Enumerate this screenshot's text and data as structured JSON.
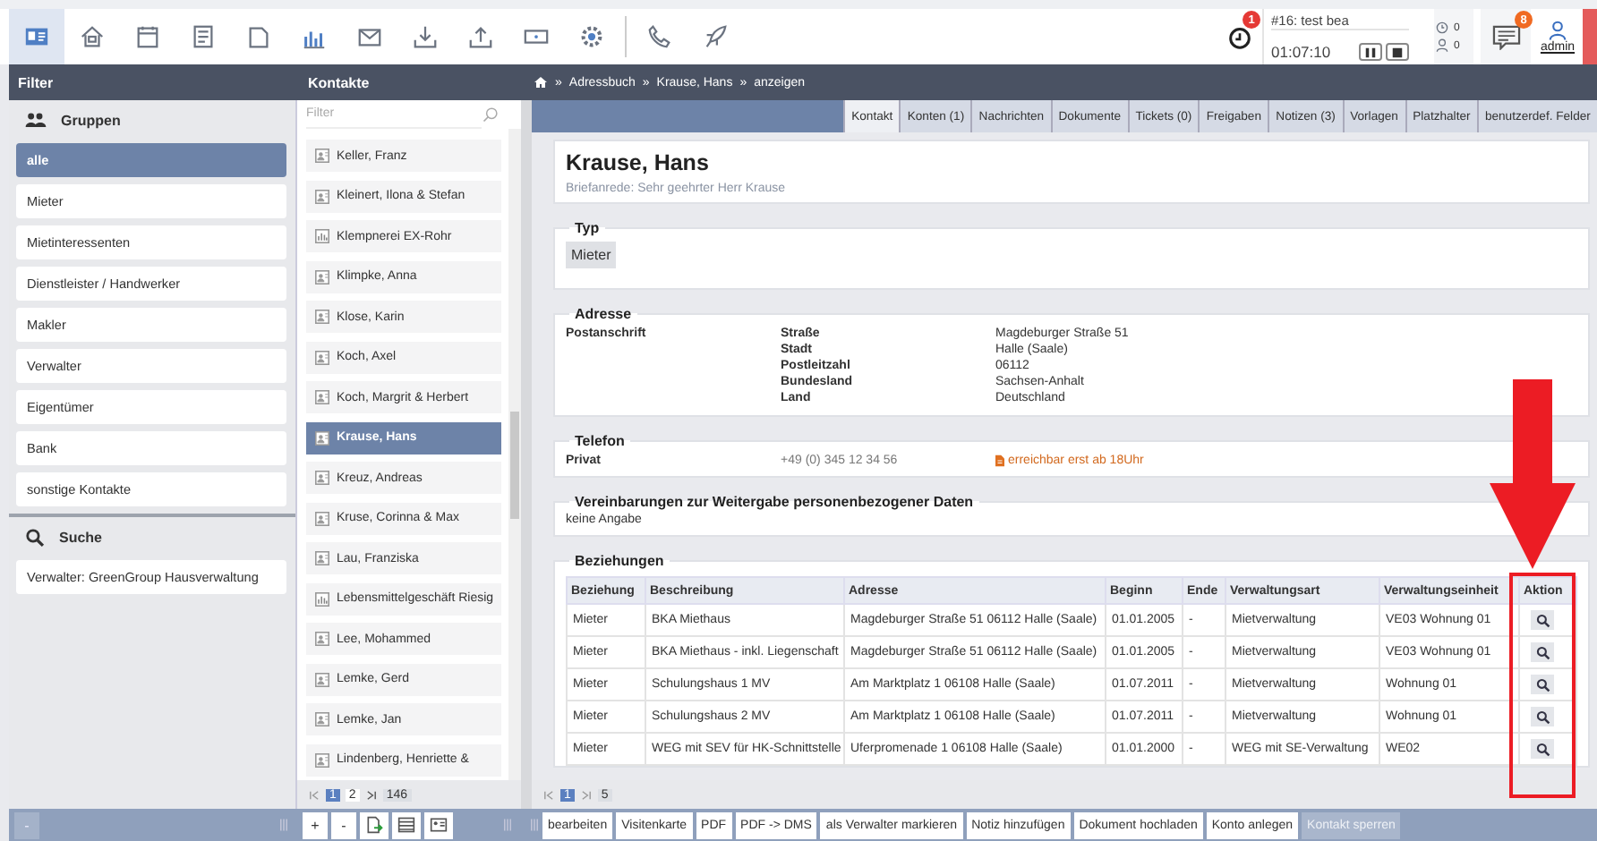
{
  "toolbar": {
    "buttons": [
      {
        "kind": "contacts",
        "selected": true
      },
      {
        "kind": "house",
        "selected": false
      },
      {
        "kind": "calendar",
        "selected": false
      },
      {
        "kind": "form",
        "selected": false
      },
      {
        "kind": "pages",
        "selected": false
      },
      {
        "kind": "chart",
        "selected": false
      },
      {
        "kind": "mail",
        "selected": false
      },
      {
        "kind": "download",
        "selected": false
      },
      {
        "kind": "upload",
        "selected": false
      },
      {
        "kind": "ticket",
        "selected": false
      },
      {
        "kind": "gear",
        "selected": false
      }
    ],
    "tools": [
      {
        "kind": "phone"
      },
      {
        "kind": "rocket"
      }
    ]
  },
  "status": {
    "alarm_badge": "1",
    "task": "#16: test bea",
    "timer": "01:07:10",
    "counters": [
      {
        "kind": "clock",
        "count": "0"
      },
      {
        "kind": "person",
        "count": "0"
      }
    ],
    "messages_badge": "8",
    "user": "admin"
  },
  "filter_panel": {
    "title": "Filter",
    "groups_heading": "Gruppen",
    "groups": [
      {
        "label": "alle",
        "selected": true
      },
      {
        "label": "Mieter",
        "selected": false
      },
      {
        "label": "Mietinteressenten",
        "selected": false
      },
      {
        "label": "Dienstleister / Handwerker",
        "selected": false
      },
      {
        "label": "Makler",
        "selected": false
      },
      {
        "label": "Verwalter",
        "selected": false
      },
      {
        "label": "Eigentümer",
        "selected": false
      },
      {
        "label": "Bank",
        "selected": false
      },
      {
        "label": "sonstige Kontakte",
        "selected": false
      }
    ],
    "search_heading": "Suche",
    "searches": [
      "Verwalter: GreenGroup Hausverwaltung"
    ],
    "collapse": "-"
  },
  "contacts_panel": {
    "title": "Kontakte",
    "filter_placeholder": "Filter",
    "contacts": [
      {
        "name": "Keller, Franz",
        "kind": "person",
        "selected": false
      },
      {
        "name": "Kleinert, Ilona & Stefan",
        "kind": "person",
        "selected": false
      },
      {
        "name": "Klempnerei EX-Rohr",
        "kind": "company",
        "selected": false
      },
      {
        "name": "Klimpke, Anna",
        "kind": "person",
        "selected": false
      },
      {
        "name": "Klose, Karin",
        "kind": "person",
        "selected": false
      },
      {
        "name": "Koch, Axel",
        "kind": "person",
        "selected": false
      },
      {
        "name": "Koch, Margrit & Herbert",
        "kind": "person",
        "selected": false
      },
      {
        "name": "Krause, Hans",
        "kind": "person",
        "selected": true
      },
      {
        "name": "Kreuz, Andreas",
        "kind": "person",
        "selected": false
      },
      {
        "name": "Kruse, Corinna & Max",
        "kind": "person",
        "selected": false
      },
      {
        "name": "Lau, Franziska",
        "kind": "person",
        "selected": false
      },
      {
        "name": "Lebensmittelgeschäft Riesig",
        "kind": "company",
        "selected": false
      },
      {
        "name": "Lee, Mohammed",
        "kind": "person",
        "selected": false
      },
      {
        "name": "Lemke, Gerd",
        "kind": "person",
        "selected": false
      },
      {
        "name": "Lemke, Jan",
        "kind": "person",
        "selected": false
      },
      {
        "name": "Lindenberg, Henriette &",
        "kind": "person",
        "selected": false
      }
    ],
    "pager": {
      "pages": [
        {
          "label": "1",
          "selected": true
        },
        {
          "label": "2",
          "selected": false
        }
      ],
      "total": "146"
    },
    "tools": [
      "+",
      "-"
    ]
  },
  "breadcrumb": {
    "separator": "»",
    "items": [
      "Adressbuch",
      "Krause, Hans",
      "anzeigen"
    ]
  },
  "tabs": [
    {
      "label": "Kontakt",
      "selected": true
    },
    {
      "label": "Konten (1)",
      "selected": false
    },
    {
      "label": "Nachrichten",
      "selected": false
    },
    {
      "label": "Dokumente",
      "selected": false
    },
    {
      "label": "Tickets (0)",
      "selected": false
    },
    {
      "label": "Freigaben",
      "selected": false
    },
    {
      "label": "Notizen (3)",
      "selected": false
    },
    {
      "label": "Vorlagen",
      "selected": false
    },
    {
      "label": "Platzhalter",
      "selected": false
    },
    {
      "label": "benutzerdef. Felder",
      "selected": false
    }
  ],
  "contact": {
    "name": "Krause, Hans",
    "salutation": "Briefanrede: Sehr geehrter Herr Krause",
    "type_legend": "Typ",
    "types": [
      "Mieter"
    ],
    "address_legend": "Adresse",
    "address_label": "Postanschrift",
    "address_fields": [
      {
        "label": "Straße",
        "value": "Magdeburger Straße 51"
      },
      {
        "label": "Stadt",
        "value": "Halle (Saale)"
      },
      {
        "label": "Postleitzahl",
        "value": "06112"
      },
      {
        "label": "Bundesland",
        "value": "Sachsen-Anhalt"
      },
      {
        "label": "Land",
        "value": "Deutschland"
      }
    ],
    "phone_legend": "Telefon",
    "phones": [
      {
        "label": "Privat",
        "number": "+49 (0) 345 12 34 56",
        "note": "erreichbar erst ab 18Uhr"
      }
    ],
    "consent_legend": "Vereinbarungen zur Weitergabe personenbezogener Daten",
    "consent": "keine Angabe",
    "relations_legend": "Beziehungen",
    "relations": {
      "columns": [
        "Beziehung",
        "Beschreibung",
        "Adresse",
        "Beginn",
        "Ende",
        "Verwaltungsart",
        "Verwaltungseinheit",
        "Aktion"
      ],
      "rows": [
        [
          "Mieter",
          "BKA Miethaus",
          "Magdeburger Straße 51 06112 Halle (Saale)",
          "01.01.2005",
          "-",
          "Mietverwaltung",
          "VE03 Wohnung 01"
        ],
        [
          "Mieter",
          "BKA Miethaus - inkl. Liegenschaft",
          "Magdeburger Straße 51 06112 Halle (Saale)",
          "01.01.2005",
          "-",
          "Mietverwaltung",
          "VE03 Wohnung 01"
        ],
        [
          "Mieter",
          "Schulungshaus 1 MV",
          "Am Marktplatz 1 06108 Halle (Saale)",
          "01.07.2011",
          "-",
          "Mietverwaltung",
          "Wohnung 01"
        ],
        [
          "Mieter",
          "Schulungshaus 2 MV",
          "Am Marktplatz 1 06108 Halle (Saale)",
          "01.07.2011",
          "-",
          "Mietverwaltung",
          "Wohnung 01"
        ],
        [
          "Mieter",
          "WEG mit SEV für HK-Schnittstelle",
          "Uferpromenade 1 06108 Halle (Saale)",
          "01.01.2000",
          "-",
          "WEG mit SE-Verwaltung",
          "WE02"
        ]
      ]
    },
    "pager": {
      "pages": [
        {
          "label": "1",
          "selected": true
        }
      ],
      "total": "5"
    }
  },
  "actions": [
    {
      "label": "bearbeiten",
      "disabled": false
    },
    {
      "label": "Visitenkarte",
      "disabled": false
    },
    {
      "label": "PDF",
      "disabled": false
    },
    {
      "label": "PDF -> DMS",
      "disabled": false
    },
    {
      "label": "als Verwalter markieren",
      "disabled": false
    },
    {
      "label": "Notiz hinzufügen",
      "disabled": false
    },
    {
      "label": "Dokument hochladen",
      "disabled": false
    },
    {
      "label": "Konto anlegen",
      "disabled": false
    },
    {
      "label": "Kontakt sperren",
      "disabled": true
    }
  ]
}
